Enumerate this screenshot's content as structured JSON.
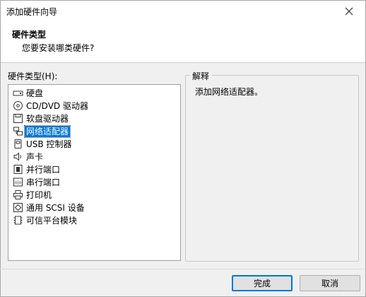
{
  "window": {
    "title": "添加硬件向导"
  },
  "header": {
    "title": "硬件类型",
    "subtitle": "您要安装哪类硬件?"
  },
  "hardware_list": {
    "label": "硬件类型(H):",
    "items": [
      {
        "label": "硬盘",
        "icon": "hard-disk-icon"
      },
      {
        "label": "CD/DVD 驱动器",
        "icon": "cd-dvd-icon"
      },
      {
        "label": "软盘驱动器",
        "icon": "floppy-icon"
      },
      {
        "label": "网络适配器",
        "icon": "network-adapter-icon"
      },
      {
        "label": "USB 控制器",
        "icon": "usb-icon"
      },
      {
        "label": "声卡",
        "icon": "speaker-icon"
      },
      {
        "label": "并行端口",
        "icon": "parallel-port-icon"
      },
      {
        "label": "串行端口",
        "icon": "serial-port-icon"
      },
      {
        "label": "打印机",
        "icon": "printer-icon"
      },
      {
        "label": "通用 SCSI 设备",
        "icon": "scsi-icon"
      },
      {
        "label": "可信平台模块",
        "icon": "tpm-icon"
      }
    ],
    "selected": "网络适配器"
  },
  "explanation": {
    "legend": "解释",
    "text": "添加网络适配器。"
  },
  "buttons": {
    "finish": "完成",
    "cancel": "取消"
  },
  "colors": {
    "selection": "#0078d7"
  }
}
